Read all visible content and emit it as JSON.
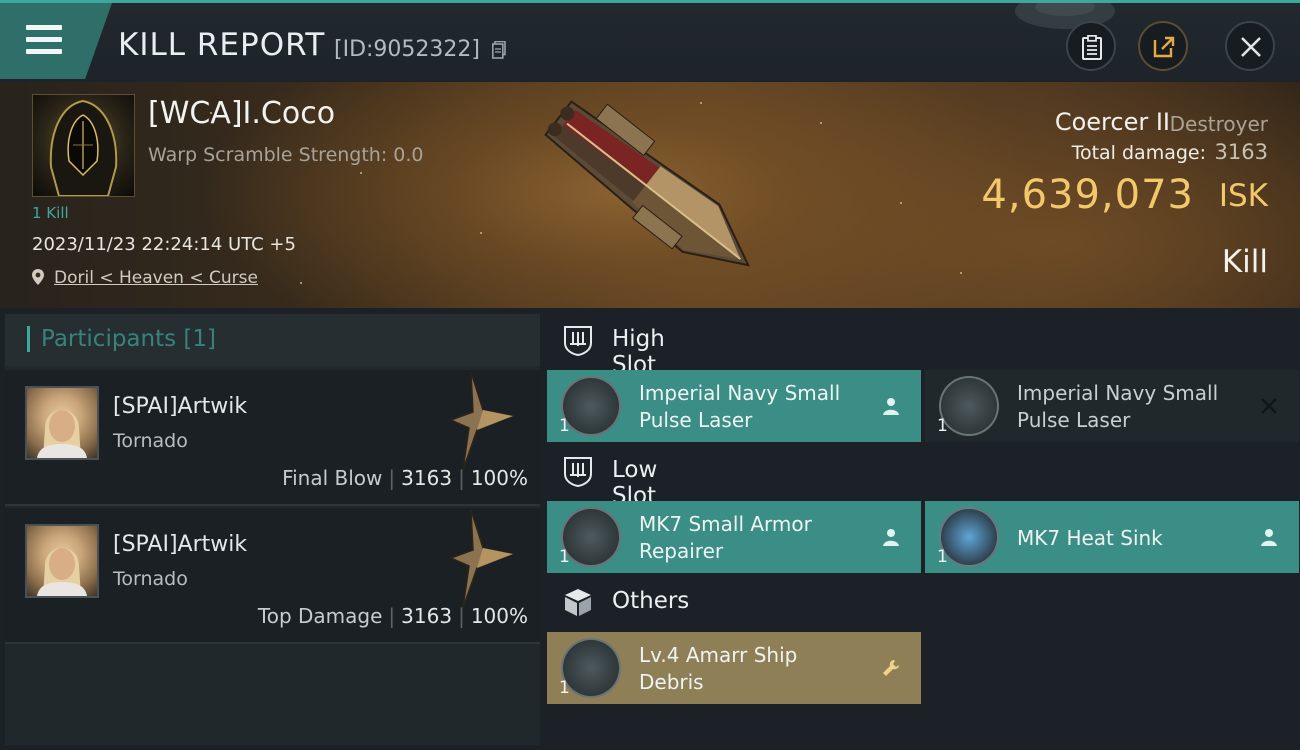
{
  "header": {
    "title": "KILL REPORT",
    "report_id": "[ID:9052322]"
  },
  "victim": {
    "name": "[WCA]I.Coco",
    "warp_scramble": "Warp Scramble Strength: 0.0",
    "kills": "1 Kill",
    "datetime": "2023/11/23 22:24:14 UTC +5",
    "location": "Doril < Heaven < Curse",
    "ship_name": "Coercer II",
    "ship_class": "Destroyer",
    "total_damage_label": "Total damage:",
    "total_damage_value": "3163",
    "isk_value": "4,639,073",
    "isk_unit": "ISK",
    "result": "Kill"
  },
  "participants": {
    "title": "Participants",
    "count": "[1]",
    "list": [
      {
        "name": "[SPAI]Artwik",
        "ship": "Tornado",
        "tag": "Final Blow",
        "damage": "3163",
        "percent": "100%"
      },
      {
        "name": "[SPAI]Artwik",
        "ship": "Tornado",
        "tag": "Top Damage",
        "damage": "3163",
        "percent": "100%"
      }
    ]
  },
  "slots": {
    "high": {
      "label": "High Slot",
      "items": [
        {
          "name": "Imperial Navy Small Pulse Laser",
          "qty": "1",
          "state": "dropped"
        },
        {
          "name": "Imperial Navy Small Pulse Laser",
          "qty": "1",
          "state": "destroyed"
        }
      ]
    },
    "low": {
      "label": "Low Slot",
      "items": [
        {
          "name": "MK7 Small Armor Repairer",
          "qty": "1",
          "state": "dropped"
        },
        {
          "name": "MK7 Heat Sink",
          "qty": "1",
          "state": "dropped"
        }
      ]
    },
    "others": {
      "label": "Others",
      "items": [
        {
          "name": "Lv.4 Amarr Ship Debris",
          "qty": "1",
          "state": "material"
        }
      ]
    }
  },
  "colors": {
    "accent": "#3fa89c",
    "isk": "#f2c86a",
    "dropped_item": "#3b8e86",
    "destroyed_item": "#21282c",
    "material_item": "#8f7f57"
  }
}
